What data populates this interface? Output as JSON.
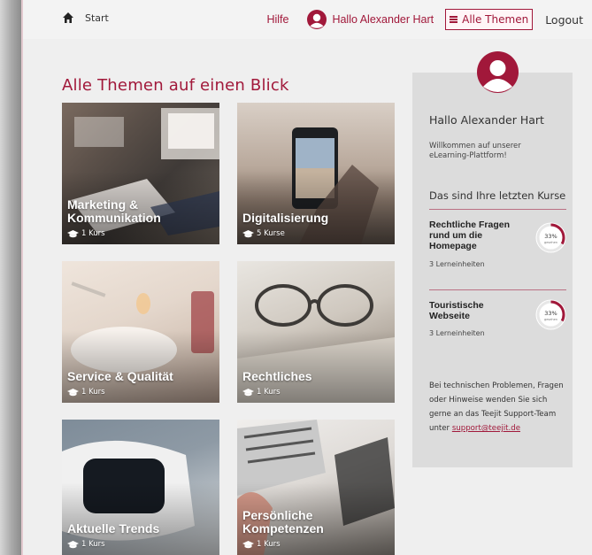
{
  "breadcrumb": {
    "label": "Start"
  },
  "nav": {
    "help": "Hilfe",
    "user_greeting": "Hallo Alexander Hart",
    "themes_label": "Alle Themen",
    "logout": "Logout"
  },
  "page_title": "Alle Themen auf einen Blick",
  "tiles": [
    {
      "title": "Marketing & Kommunikation",
      "count": "1 Kurs"
    },
    {
      "title": "Digitalisierung",
      "count": "5 Kurse"
    },
    {
      "title": "Service & Qualität",
      "count": "1 Kurs"
    },
    {
      "title": "Rechtliches",
      "count": "1 Kurs"
    },
    {
      "title": "Aktuelle Trends",
      "count": "1 Kurs"
    },
    {
      "title": "Persönliche Kompetenzen",
      "count": "1 Kurs"
    }
  ],
  "sidebar": {
    "hello": "Hallo Alexander Hart",
    "welcome": "Willkommen auf unserer eLearning-Plattform!",
    "last_courses": "Das sind Ihre letzten Kurse",
    "courses": [
      {
        "title": "Rechtliche Fragen rund um die Homepage",
        "units": "3 Lerneinheiten",
        "progress": 33,
        "progress_label": "33%",
        "progress_sub": "gesehen"
      },
      {
        "title": "Touristische Webseite",
        "units": "3 Lerneinheiten",
        "progress": 33,
        "progress_label": "33%",
        "progress_sub": "gesehen"
      }
    ],
    "help_text": "Bei technischen Problemen, Fragen oder Hinweise wenden Sie sich gerne an das Teejit Support-Team unter",
    "support_email": "support@teejit.de"
  },
  "colors": {
    "accent": "#a1183a",
    "sidebar_bg": "#dcdcdc",
    "page_bg": "#efefef"
  }
}
